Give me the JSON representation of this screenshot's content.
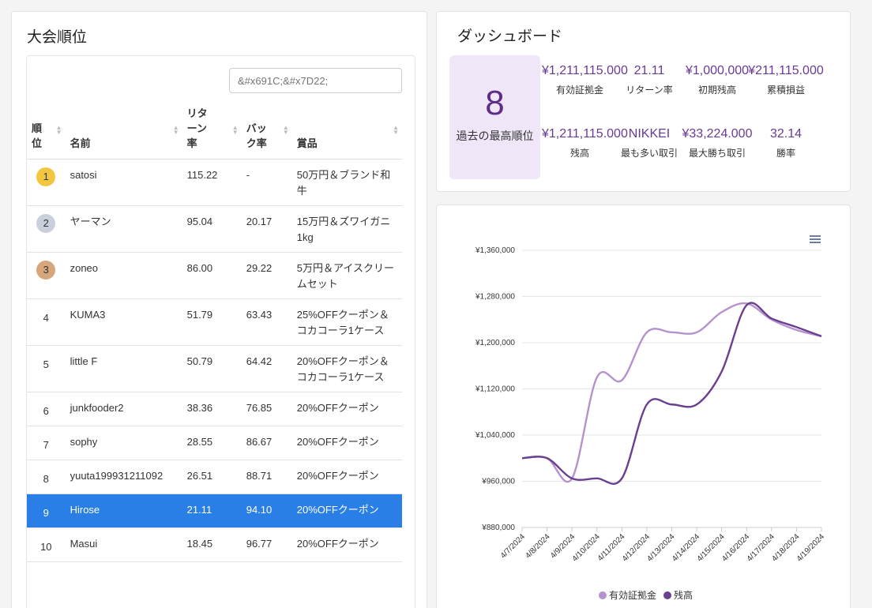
{
  "ranking": {
    "title": "大会順位",
    "search_placeholder": "&#x691C;&#x7D22;",
    "columns": [
      "順位",
      "名前",
      "リターン率",
      "バック率",
      "賞品"
    ],
    "column_lines": [
      [
        "順",
        "位"
      ],
      [
        "名前"
      ],
      [
        "リタ",
        "ーン",
        "率"
      ],
      [
        "バッ",
        "ク率"
      ],
      [
        "賞品"
      ]
    ],
    "rows": [
      {
        "rank": "1",
        "name": "satosi",
        "return": "115.22",
        "back": "-",
        "prize": "50万円＆ブランド和牛",
        "medal": "gold"
      },
      {
        "rank": "2",
        "name": "ヤーマン",
        "return": "95.04",
        "back": "20.17",
        "prize": "15万円＆ズワイガニ1kg",
        "medal": "silver"
      },
      {
        "rank": "3",
        "name": "zoneo",
        "return": "86.00",
        "back": "29.22",
        "prize": "5万円＆アイスクリームセット",
        "medal": "bronze"
      },
      {
        "rank": "4",
        "name": "KUMA3",
        "return": "51.79",
        "back": "63.43",
        "prize": "25%OFFクーポン＆コカコーラ1ケース",
        "medal": ""
      },
      {
        "rank": "5",
        "name": "little F",
        "return": "50.79",
        "back": "64.42",
        "prize": "20%OFFクーポン＆コカコーラ1ケース",
        "medal": ""
      },
      {
        "rank": "6",
        "name": "junkfooder2",
        "return": "38.36",
        "back": "76.85",
        "prize": "20%OFFクーポン",
        "medal": ""
      },
      {
        "rank": "7",
        "name": "sophy",
        "return": "28.55",
        "back": "86.67",
        "prize": "20%OFFクーポン",
        "medal": ""
      },
      {
        "rank": "8",
        "name": "yuuta199931211092",
        "return": "26.51",
        "back": "88.71",
        "prize": "20%OFFクーポン",
        "medal": ""
      },
      {
        "rank": "9",
        "name": "Hirose",
        "return": "21.11",
        "back": "94.10",
        "prize": "20%OFFクーポン",
        "medal": "",
        "selected": true
      },
      {
        "rank": "10",
        "name": "Masui",
        "return": "18.45",
        "back": "96.77",
        "prize": "20%OFFクーポン",
        "medal": ""
      }
    ]
  },
  "colors": {
    "gold": "#f3c63f",
    "silver": "#c9d0dc",
    "bronze": "#d7a67b",
    "selected": "#2a7fe6",
    "accent": "#6a3a92",
    "series_margin": "#b592cc",
    "series_balance": "#6a3f8f"
  },
  "dashboard": {
    "title": "ダッシュボード",
    "best_rank": "8",
    "best_rank_label": "過去の最高順位",
    "stats": [
      {
        "value": "¥1,211,115.000",
        "label": "有効証拠金"
      },
      {
        "value": "21.11",
        "label": "リターン率"
      },
      {
        "value": "¥1,000,000",
        "label": "初期残高"
      },
      {
        "value": "¥211,115.000",
        "label": "累積損益"
      },
      {
        "value": "¥1,211,115.000",
        "label": "残高"
      },
      {
        "value": "NIKKEI",
        "label": "最も多い取引"
      },
      {
        "value": "¥33,224.000",
        "label": "最大勝ち取引"
      },
      {
        "value": "32.14",
        "label": "勝率"
      }
    ]
  },
  "menu_icon": "hamburger-menu-icon",
  "chart_data": {
    "type": "line",
    "x": [
      "4/7/2024",
      "4/8/2024",
      "4/9/2024",
      "4/10/2024",
      "4/11/2024",
      "4/12/2024",
      "4/13/2024",
      "4/14/2024",
      "4/15/2024",
      "4/16/2024",
      "4/17/2024",
      "4/18/2024",
      "4/19/2024"
    ],
    "yticks": [
      "¥1,360,000",
      "¥1,280,000",
      "¥1,200,000",
      "¥1,120,000",
      "¥1,040,000",
      "¥960,000",
      "¥880,000"
    ],
    "ylim": [
      880000,
      1360000
    ],
    "series": [
      {
        "name": "有効証拠金",
        "values": [
          1000000,
          1000000,
          965000,
          1140000,
          1135000,
          1218000,
          1218000,
          1218000,
          1253000,
          1268000,
          1240000,
          1222000,
          1211115
        ]
      },
      {
        "name": "残高",
        "values": [
          1000000,
          1000000,
          965000,
          965000,
          965000,
          1093000,
          1093000,
          1093000,
          1150000,
          1265000,
          1242000,
          1227000,
          1211115
        ]
      }
    ],
    "legend": "bottom",
    "grid": true
  }
}
